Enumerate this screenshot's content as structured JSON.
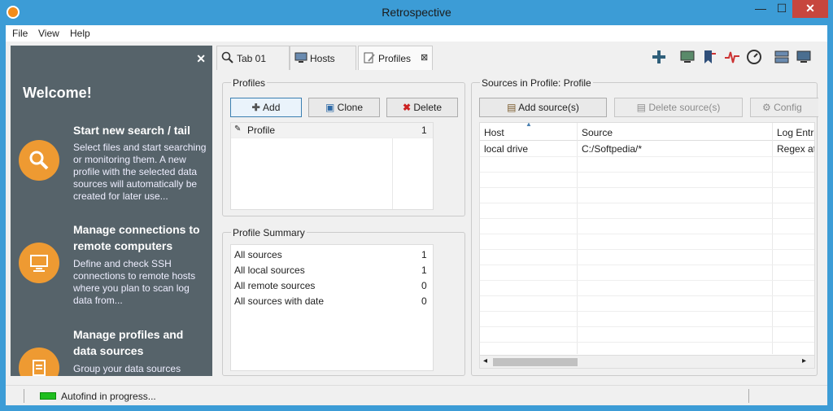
{
  "window": {
    "title": "Retrospective",
    "min": "—",
    "max": "☐",
    "close": "✕"
  },
  "menu": [
    "File",
    "View",
    "Help"
  ],
  "welcome": {
    "close": "✕",
    "heading": "Welcome!",
    "sections": [
      {
        "icon": "search-icon",
        "title": "Start new search / tail",
        "text": "Select files and start searching or monitoring them. A new profile with the selected data sources will automatically be created for later use..."
      },
      {
        "icon": "computer-icon",
        "title": "Manage connections to remote computers",
        "text": "Define and check SSH connections to remote hosts where you plan to scan log data from..."
      },
      {
        "icon": "profile-icon",
        "title": "Manage profiles and data sources",
        "text": "Group your data sources"
      }
    ]
  },
  "tabs": [
    {
      "label": "Tab 01",
      "icon": "search-icon"
    },
    {
      "label": "Hosts",
      "icon": "hosts-icon"
    },
    {
      "label": "Profiles",
      "icon": "profile-icon",
      "close": "⊠"
    }
  ],
  "profiles": {
    "title": "Profiles",
    "add": "Add",
    "clone": "Clone",
    "delete": "Delete",
    "items": [
      {
        "name": "Profile",
        "count": "1"
      }
    ]
  },
  "summary": {
    "title": "Profile Summary",
    "rows": [
      {
        "label": "All sources",
        "value": "1"
      },
      {
        "label": "All local sources",
        "value": "1"
      },
      {
        "label": "All remote sources",
        "value": "0"
      },
      {
        "label": "All sources with date",
        "value": "0"
      }
    ]
  },
  "sources": {
    "title": "Sources in Profile: Profile",
    "add": "Add source(s)",
    "delete": "Delete source(s)",
    "config": "Config",
    "columns": [
      "Host",
      "Source",
      "Log Entr"
    ],
    "rows": [
      {
        "host": "local drive",
        "source": "C:/Softpedia/*",
        "log": "Regex at"
      }
    ]
  },
  "status": {
    "text": "Autofind in progress..."
  },
  "colors": {
    "accent": "#3c9cd6",
    "welcome_bg": "#56636a",
    "circle": "#ee9a32",
    "progress": "#1fbe1f"
  }
}
